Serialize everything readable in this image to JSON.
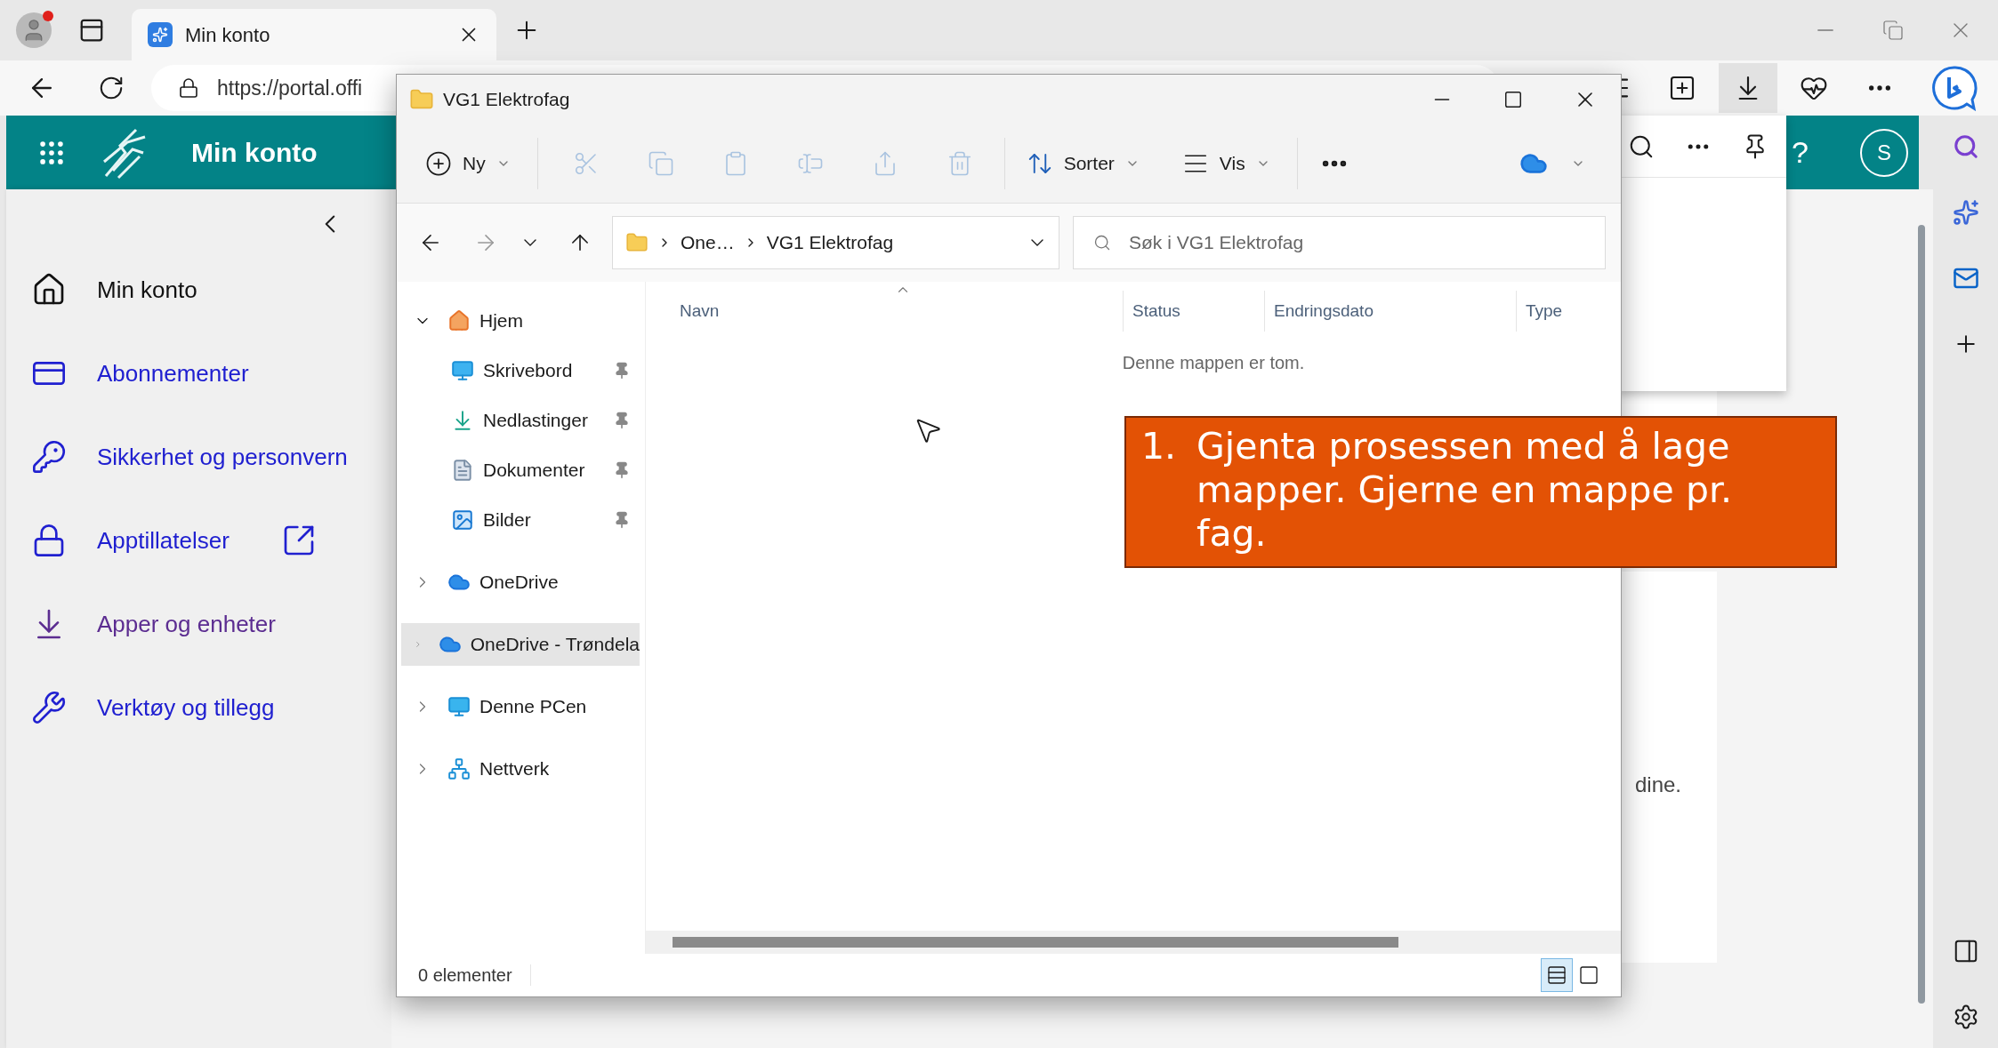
{
  "browser": {
    "tab_title": "Min konto",
    "url": "https://portal.offi"
  },
  "page": {
    "header_title": "Min konto",
    "help": "?",
    "avatar_initial": "S",
    "nav": [
      {
        "label": "Min konto",
        "kind": "home",
        "selected": true,
        "visited": false,
        "external": false
      },
      {
        "label": "Abonnementer",
        "kind": "card",
        "selected": false,
        "visited": false,
        "external": false
      },
      {
        "label": "Sikkerhet og personvern",
        "kind": "key",
        "selected": false,
        "visited": false,
        "external": false
      },
      {
        "label": "Apptillatelser",
        "kind": "lock",
        "selected": false,
        "visited": false,
        "external": true
      },
      {
        "label": "Apper og enheter",
        "kind": "download",
        "selected": false,
        "visited": true,
        "external": false
      },
      {
        "label": "Verktøy og tillegg",
        "kind": "wrench",
        "selected": false,
        "visited": false,
        "external": false
      }
    ],
    "partial_text": "dine."
  },
  "explorer": {
    "title": "VG1 Elektrofag",
    "toolbar": {
      "new": "Ny",
      "sort": "Sorter",
      "view": "Vis"
    },
    "breadcrumb": [
      "One…",
      "VG1 Elektrofag"
    ],
    "search": {
      "placeholder": "Søk i VG1 Elektrofag"
    },
    "nav": [
      {
        "label": "Hjem",
        "kind": "home",
        "expanded": true,
        "selected": false,
        "children": [
          {
            "label": "Skrivebord",
            "kind": "desktop",
            "pinned": true
          },
          {
            "label": "Nedlastinger",
            "kind": "downloads",
            "pinned": true
          },
          {
            "label": "Dokumenter",
            "kind": "documents",
            "pinned": true
          },
          {
            "label": "Bilder",
            "kind": "pictures",
            "pinned": true
          }
        ]
      },
      {
        "label": "OneDrive",
        "kind": "cloud",
        "expanded": false,
        "selected": false
      },
      {
        "label": "OneDrive - Trøndela",
        "kind": "cloud",
        "expanded": false,
        "selected": true
      },
      {
        "label": "Denne PCen",
        "kind": "pc",
        "expanded": false,
        "selected": false
      },
      {
        "label": "Nettverk",
        "kind": "network",
        "expanded": false,
        "selected": false
      }
    ],
    "columns": [
      "Navn",
      "Status",
      "Endringsdato",
      "Type"
    ],
    "empty_message": "Denne mappen er tom.",
    "status_bar": "0 elementer",
    "view_modes": [
      {
        "kind": "details",
        "selected": true
      },
      {
        "kind": "tiles",
        "selected": false
      }
    ]
  },
  "callout": {
    "number": "1.",
    "text": "Gjenta prosessen med å lage mapper. Gjerne en mappe pr. fag."
  }
}
